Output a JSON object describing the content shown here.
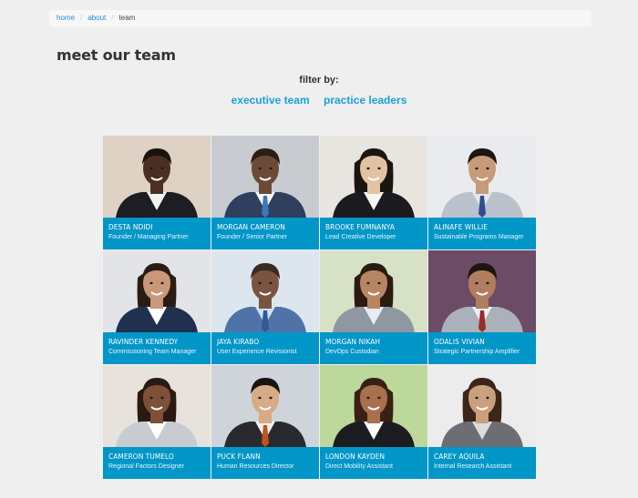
{
  "breadcrumb": {
    "home": "home",
    "about": "about",
    "current": "team"
  },
  "page_title": "meet our team",
  "filter": {
    "label": "filter by:",
    "options": [
      "executive team",
      "practice leaders"
    ]
  },
  "team": [
    {
      "name": "DESTA NDIDI",
      "role": "Founder / Managing Partner"
    },
    {
      "name": "MORGAN CAMERON",
      "role": "Founder / Senior Partner"
    },
    {
      "name": "BROOKE FUMNANYA",
      "role": "Lead Creative Developer"
    },
    {
      "name": "ALINAFE WILLIE",
      "role": "Sustainable Programs Manager"
    },
    {
      "name": "RAVINDER KENNEDY",
      "role": "Commissioning Team Manager"
    },
    {
      "name": "JAYA KIRABO",
      "role": "User Experience Revisionist"
    },
    {
      "name": "MORGAN NIKAH",
      "role": "DevOps Custodian"
    },
    {
      "name": "ODALIS VIVIAN",
      "role": "Strategic Partnership Amplifier"
    },
    {
      "name": "CAMERON TUMELO",
      "role": "Regional Factors Designer"
    },
    {
      "name": "PUCK FLANN",
      "role": "Human Resources Director"
    },
    {
      "name": "LONDON KAYDEN",
      "role": "Direct Mobility Assistant"
    },
    {
      "name": "CAREY AQUILA",
      "role": "Internal Research Assistant"
    }
  ],
  "colors": {
    "accent": "#0096c8",
    "link": "#1aa1d6",
    "background": "#efefef"
  }
}
